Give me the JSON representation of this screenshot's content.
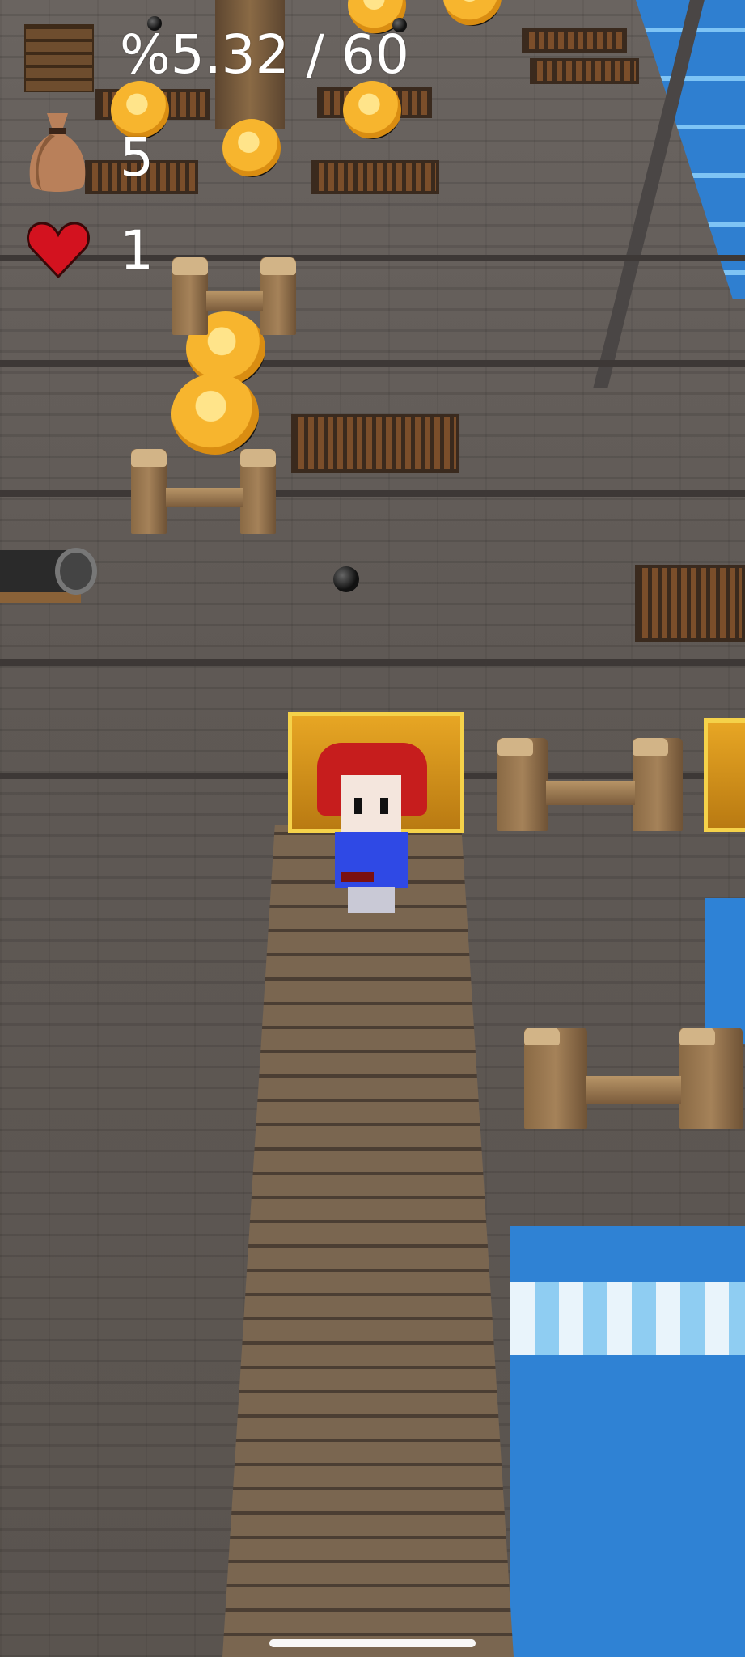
{
  "hud": {
    "progress_text": "%5.32 / 60",
    "coins_count": "5",
    "lives_count": "1"
  },
  "icons": {
    "progress": "brick-wall-icon",
    "coins": "money-bag-icon",
    "lives": "heart-icon"
  },
  "colors": {
    "hud_text": "#ffffff",
    "heart": "#d3121f",
    "sea": "#2f82d4",
    "coin": "#f7b52e"
  }
}
